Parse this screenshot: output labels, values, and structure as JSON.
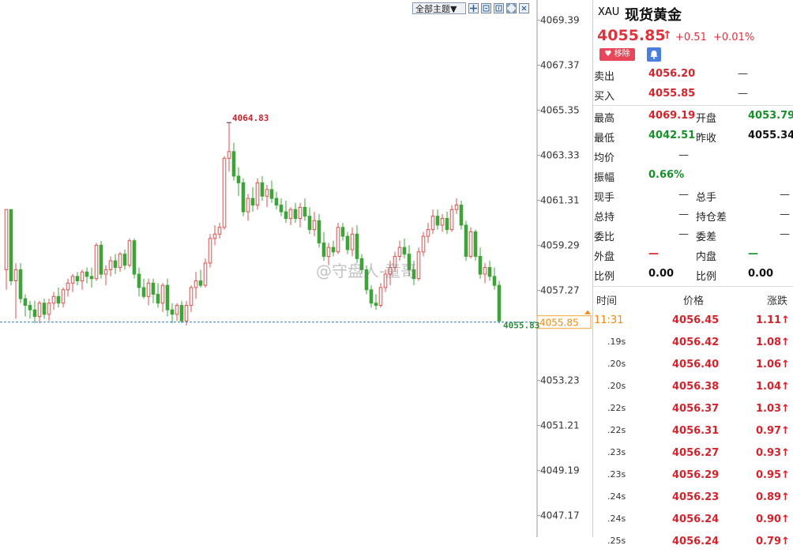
{
  "toolbar": {
    "theme_label": "全部主题▼"
  },
  "chart_data": {
    "type": "candlestick",
    "ylim": [
      4046.2,
      4070.3
    ],
    "yticks": [
      "4069.39",
      "4067.37",
      "4065.35",
      "4063.33",
      "4061.31",
      "4059.29",
      "4057.27",
      "4053.23",
      "4051.21",
      "4049.19",
      "4047.17"
    ],
    "high_label": "4064.83",
    "last_label": "4055.83",
    "last_price_box": "4055.85",
    "candles": [
      [
        4058.2,
        4060.9,
        4057.3,
        4060.9
      ],
      [
        4060.9,
        4060.9,
        4057.5,
        4057.7
      ],
      [
        4057.7,
        4058.5,
        4056.0,
        4058.2
      ],
      [
        4058.2,
        4058.5,
        4056.7,
        4056.9
      ],
      [
        4056.9,
        4057.1,
        4056.1,
        4056.6
      ],
      [
        4056.6,
        4056.8,
        4056.0,
        4056.4
      ],
      [
        4056.4,
        4056.8,
        4055.8,
        4056.1
      ],
      [
        4056.1,
        4056.8,
        4055.8,
        4056.7
      ],
      [
        4056.7,
        4056.9,
        4056.0,
        4056.2
      ],
      [
        4056.2,
        4056.9,
        4055.9,
        4056.7
      ],
      [
        4056.7,
        4057.2,
        4056.4,
        4057.0
      ],
      [
        4057.0,
        4057.4,
        4056.5,
        4056.7
      ],
      [
        4056.7,
        4057.4,
        4056.5,
        4057.3
      ],
      [
        4057.3,
        4057.8,
        4057.0,
        4057.6
      ],
      [
        4057.6,
        4058.0,
        4057.2,
        4057.9
      ],
      [
        4057.9,
        4058.1,
        4057.5,
        4057.7
      ],
      [
        4057.7,
        4058.2,
        4057.3,
        4058.1
      ],
      [
        4058.1,
        4058.3,
        4057.6,
        4057.9
      ],
      [
        4057.9,
        4058.3,
        4057.4,
        4057.8
      ],
      [
        4057.8,
        4059.4,
        4057.7,
        4059.3
      ],
      [
        4059.3,
        4059.5,
        4057.8,
        4058.0
      ],
      [
        4058.0,
        4058.4,
        4057.5,
        4058.2
      ],
      [
        4058.2,
        4058.8,
        4057.9,
        4058.6
      ],
      [
        4058.6,
        4058.9,
        4058.0,
        4058.3
      ],
      [
        4058.3,
        4059.0,
        4058.1,
        4058.9
      ],
      [
        4058.9,
        4059.1,
        4058.2,
        4058.4
      ],
      [
        4058.4,
        4059.6,
        4058.3,
        4059.5
      ],
      [
        4059.5,
        4059.6,
        4057.8,
        4058.0
      ],
      [
        4058.0,
        4058.3,
        4057.0,
        4057.4
      ],
      [
        4057.4,
        4057.8,
        4056.9,
        4057.0
      ],
      [
        4057.0,
        4057.8,
        4056.6,
        4057.6
      ],
      [
        4057.6,
        4057.8,
        4056.7,
        4057.1
      ],
      [
        4057.1,
        4057.6,
        4056.5,
        4056.7
      ],
      [
        4056.7,
        4057.6,
        4056.3,
        4057.5
      ],
      [
        4057.5,
        4057.8,
        4056.1,
        4056.4
      ],
      [
        4056.4,
        4056.7,
        4055.8,
        4056.2
      ],
      [
        4056.2,
        4056.7,
        4055.9,
        4056.6
      ],
      [
        4056.6,
        4056.8,
        4055.8,
        4055.9
      ],
      [
        4055.9,
        4056.8,
        4055.7,
        4056.6
      ],
      [
        4056.6,
        4057.5,
        4056.3,
        4057.4
      ],
      [
        4057.4,
        4058.1,
        4056.9,
        4057.7
      ],
      [
        4057.7,
        4058.2,
        4057.4,
        4057.5
      ],
      [
        4057.5,
        4058.7,
        4057.4,
        4058.5
      ],
      [
        4058.5,
        4059.8,
        4058.3,
        4059.6
      ],
      [
        4059.6,
        4060.2,
        4059.3,
        4059.8
      ],
      [
        4059.8,
        4060.3,
        4059.6,
        4060.1
      ],
      [
        4060.1,
        4063.3,
        4060.0,
        4063.2
      ],
      [
        4063.2,
        4064.8,
        4062.6,
        4063.5
      ],
      [
        4063.5,
        4063.9,
        4062.2,
        4062.4
      ],
      [
        4062.4,
        4062.8,
        4061.5,
        4062.1
      ],
      [
        4062.1,
        4062.3,
        4060.6,
        4060.8
      ],
      [
        4060.8,
        4061.6,
        4060.4,
        4061.4
      ],
      [
        4061.4,
        4061.9,
        4060.8,
        4061.1
      ],
      [
        4061.1,
        4062.3,
        4060.9,
        4062.1
      ],
      [
        4062.1,
        4062.4,
        4061.3,
        4061.5
      ],
      [
        4061.5,
        4062.0,
        4061.0,
        4061.8
      ],
      [
        4061.8,
        4062.2,
        4061.2,
        4061.4
      ],
      [
        4061.4,
        4061.7,
        4060.9,
        4061.1
      ],
      [
        4061.1,
        4061.4,
        4060.6,
        4060.8
      ],
      [
        4060.8,
        4061.3,
        4060.3,
        4060.5
      ],
      [
        4060.5,
        4061.0,
        4060.2,
        4060.9
      ],
      [
        4060.9,
        4061.2,
        4060.3,
        4060.5
      ],
      [
        4060.5,
        4061.2,
        4060.1,
        4061.0
      ],
      [
        4061.0,
        4061.4,
        4060.4,
        4060.6
      ],
      [
        4060.6,
        4061.0,
        4059.8,
        4060.0
      ],
      [
        4060.0,
        4060.8,
        4059.7,
        4060.4
      ],
      [
        4060.4,
        4060.7,
        4059.2,
        4059.4
      ],
      [
        4059.4,
        4059.9,
        4058.6,
        4058.8
      ],
      [
        4058.8,
        4059.4,
        4058.4,
        4059.2
      ],
      [
        4059.2,
        4059.5,
        4058.8,
        4059.0
      ],
      [
        4059.0,
        4060.3,
        4058.9,
        4060.1
      ],
      [
        4060.1,
        4060.3,
        4059.5,
        4059.7
      ],
      [
        4059.7,
        4059.9,
        4058.9,
        4059.1
      ],
      [
        4059.1,
        4060.1,
        4058.8,
        4059.8
      ],
      [
        4059.8,
        4060.2,
        4058.5,
        4058.7
      ],
      [
        4058.7,
        4058.9,
        4058.0,
        4058.2
      ],
      [
        4058.2,
        4058.4,
        4057.1,
        4057.3
      ],
      [
        4057.3,
        4057.5,
        4056.5,
        4056.7
      ],
      [
        4056.7,
        4057.1,
        4056.4,
        4056.6
      ],
      [
        4056.6,
        4057.6,
        4056.5,
        4057.4
      ],
      [
        4057.4,
        4058.2,
        4057.2,
        4058.0
      ],
      [
        4058.0,
        4058.6,
        4057.5,
        4058.3
      ],
      [
        4058.3,
        4059.0,
        4058.1,
        4058.8
      ],
      [
        4058.8,
        4059.5,
        4058.6,
        4059.2
      ],
      [
        4059.2,
        4059.6,
        4058.7,
        4058.9
      ],
      [
        4058.9,
        4059.3,
        4057.9,
        4058.2
      ],
      [
        4058.2,
        4058.6,
        4057.5,
        4057.8
      ],
      [
        4057.8,
        4059.2,
        4057.7,
        4059.0
      ],
      [
        4059.0,
        4059.9,
        4058.8,
        4059.7
      ],
      [
        4059.7,
        4060.3,
        4059.4,
        4060.0
      ],
      [
        4060.0,
        4060.9,
        4059.8,
        4060.6
      ],
      [
        4060.6,
        4060.9,
        4060.0,
        4060.2
      ],
      [
        4060.2,
        4060.7,
        4059.9,
        4060.5
      ],
      [
        4060.5,
        4060.8,
        4059.8,
        4060.0
      ],
      [
        4060.0,
        4061.1,
        4059.9,
        4060.9
      ],
      [
        4060.9,
        4061.4,
        4060.7,
        4061.1
      ],
      [
        4061.1,
        4061.3,
        4060.0,
        4060.2
      ],
      [
        4060.2,
        4060.4,
        4058.6,
        4058.8
      ],
      [
        4058.8,
        4060.1,
        4058.7,
        4059.9
      ],
      [
        4059.9,
        4060.0,
        4058.6,
        4058.8
      ],
      [
        4058.8,
        4059.2,
        4057.8,
        4058.0
      ],
      [
        4058.0,
        4058.5,
        4057.6,
        4058.3
      ],
      [
        4058.3,
        4058.6,
        4057.7,
        4057.9
      ],
      [
        4057.9,
        4058.3,
        4057.3,
        4057.5
      ],
      [
        4057.5,
        4057.7,
        4055.8,
        4055.9
      ]
    ]
  },
  "watermark": "@守盘人-童哥",
  "quote": {
    "symbol": "XAU",
    "name": "现货黄金",
    "price": "4055.85",
    "change": "+0.51",
    "change_pct": "+0.01%",
    "remove_label": "移除",
    "rows": [
      {
        "l1": "卖出",
        "v1": "4056.20",
        "v1c": "red",
        "l2": "",
        "v2": "—",
        "v2c": "dash"
      },
      {
        "l1": "买入",
        "v1": "4055.85",
        "v1c": "red",
        "l2": "",
        "v2": "—",
        "v2c": "dash"
      },
      {
        "l1": "最高",
        "v1": "4069.19",
        "v1c": "red",
        "l2": "开盘",
        "v2": "4053.79",
        "v2c": "green"
      },
      {
        "l1": "最低",
        "v1": "4042.51",
        "v1c": "green",
        "l2": "昨收",
        "v2": "4055.34",
        "v2c": "blk"
      },
      {
        "l1": "均价",
        "v1": "—",
        "v1c": "dash",
        "l2": "",
        "v2": "",
        "v2c": "dash"
      },
      {
        "l1": "振幅",
        "v1": "0.66%",
        "v1c": "green",
        "l2": "",
        "v2": "",
        "v2c": "dash"
      },
      {
        "l1": "现手",
        "v1": "—",
        "v1c": "dash",
        "l2": "总手",
        "v2": "—",
        "v2c": "dash"
      },
      {
        "l1": "总持",
        "v1": "—",
        "v1c": "dash",
        "l2": "持仓差",
        "v2": "—",
        "v2c": "dash"
      },
      {
        "l1": "委比",
        "v1": "—",
        "v1c": "dash",
        "l2": "委差",
        "v2": "—",
        "v2c": "dash"
      },
      {
        "l1": "外盘",
        "v1": "—",
        "v1c": "red",
        "l2": "内盘",
        "v2": "—",
        "v2c": "green"
      },
      {
        "l1": "比例",
        "v1": "0.00",
        "v1c": "blk",
        "l2": "比例",
        "v2": "0.00",
        "v2c": "blk"
      }
    ],
    "ticks_header": {
      "time": "时间",
      "price": "价格",
      "change": "涨跌"
    },
    "ticks": [
      {
        "time": "11:31",
        "price": "4056.45",
        "chg": "1.11"
      },
      {
        "time": ".19s",
        "price": "4056.42",
        "chg": "1.08"
      },
      {
        "time": ".20s",
        "price": "4056.40",
        "chg": "1.06"
      },
      {
        "time": ".20s",
        "price": "4056.38",
        "chg": "1.04"
      },
      {
        "time": ".22s",
        "price": "4056.37",
        "chg": "1.03"
      },
      {
        "time": ".22s",
        "price": "4056.31",
        "chg": "0.97"
      },
      {
        "time": ".23s",
        "price": "4056.27",
        "chg": "0.93"
      },
      {
        "time": ".23s",
        "price": "4056.29",
        "chg": "0.95"
      },
      {
        "time": ".24s",
        "price": "4056.23",
        "chg": "0.89"
      },
      {
        "time": ".24s",
        "price": "4056.24",
        "chg": "0.90"
      },
      {
        "time": ".25s",
        "price": "4056.24",
        "chg": "0.79"
      }
    ]
  }
}
